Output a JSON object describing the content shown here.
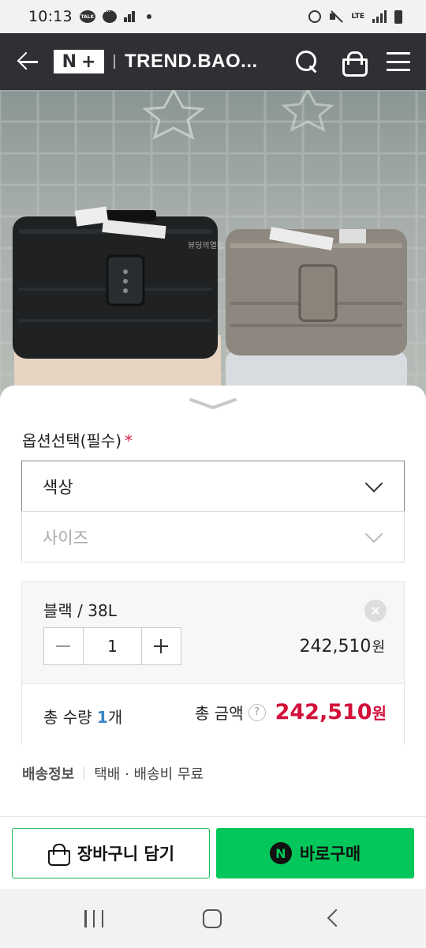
{
  "status_bar": {
    "time": "10:13",
    "talk_badge": "TALK",
    "network": "LTE"
  },
  "header": {
    "logo_text": "N",
    "logo_plus": "+",
    "store_title": "TREND.BAO..."
  },
  "product_image": {
    "watermark": "뷰딩의열정"
  },
  "options": {
    "title": "옵션선택(필수)",
    "required_mark": "*",
    "color_select": "색상",
    "size_select": "사이즈"
  },
  "selected_item": {
    "name": "블랙 / 38L",
    "quantity": "1",
    "price": "242,510",
    "currency": "원"
  },
  "totals": {
    "qty_label": "총 수량",
    "qty_value": "1",
    "qty_unit": "개",
    "amount_label": "총 금액",
    "help": "?",
    "amount_value": "242,510",
    "currency": "원"
  },
  "shipping": {
    "label": "배송정보",
    "value": "택배 · 배송비 무료"
  },
  "actions": {
    "cart_label": "장바구니 담기",
    "buy_label": "바로구매",
    "npay_mark": "N"
  },
  "colors": {
    "header_bg": "#2e3033",
    "accent_green": "#03c75a",
    "price_red": "#d3103a",
    "qty_blue": "#3a86c8"
  }
}
